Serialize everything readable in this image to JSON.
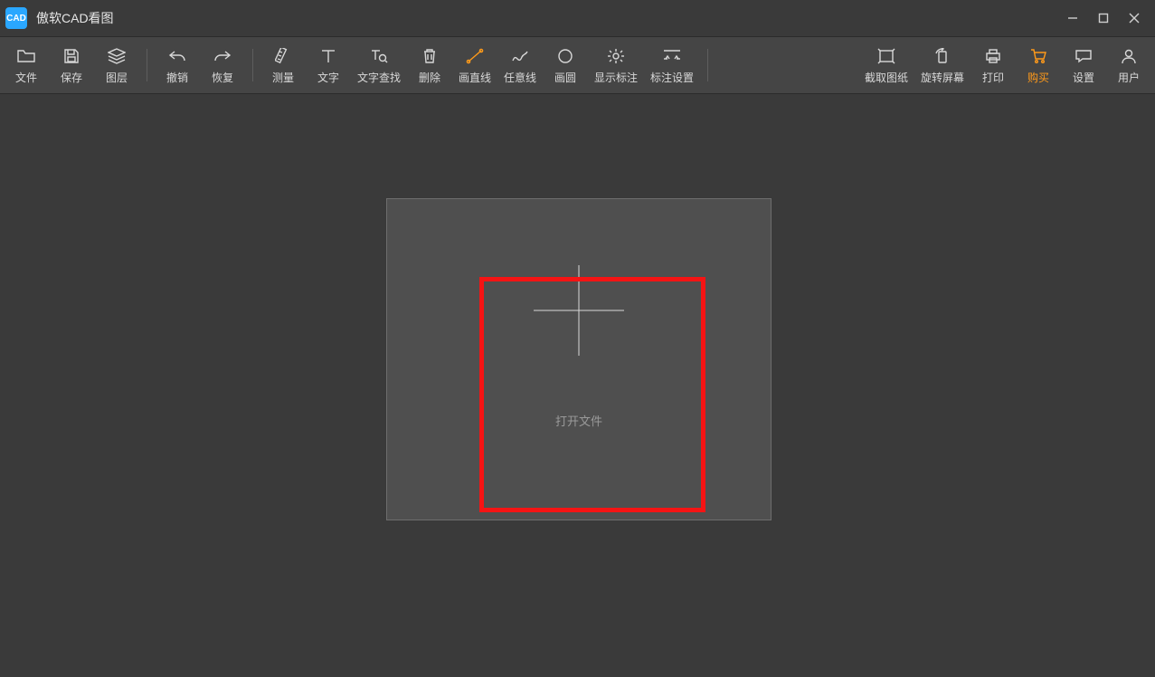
{
  "app": {
    "title": "傲软CAD看图",
    "icon_name": "cad-app-icon",
    "icon_text": "CAD"
  },
  "window_controls": {
    "minimize": "minimize",
    "maximize": "maximize",
    "close": "close"
  },
  "toolbar": {
    "file": {
      "label": "文件",
      "icon": "folder-icon"
    },
    "save": {
      "label": "保存",
      "icon": "save-icon"
    },
    "layers": {
      "label": "图层",
      "icon": "layers-icon"
    },
    "undo": {
      "label": "撤销",
      "icon": "undo-icon"
    },
    "redo": {
      "label": "恢复",
      "icon": "redo-icon"
    },
    "measure": {
      "label": "测量",
      "icon": "ruler-icon"
    },
    "text": {
      "label": "文字",
      "icon": "text-icon"
    },
    "find_text": {
      "label": "文字查找",
      "icon": "find-text-icon"
    },
    "delete": {
      "label": "删除",
      "icon": "trash-icon"
    },
    "line": {
      "label": "画直线",
      "icon": "line-icon"
    },
    "polyline": {
      "label": "任意线",
      "icon": "polyline-icon"
    },
    "circle": {
      "label": "画圆",
      "icon": "circle-icon"
    },
    "show_anno": {
      "label": "显示标注",
      "icon": "show-annotation-icon"
    },
    "anno_set": {
      "label": "标注设置",
      "icon": "annotation-settings-icon"
    },
    "capture": {
      "label": "截取图纸",
      "icon": "capture-icon"
    },
    "rotate": {
      "label": "旋转屏幕",
      "icon": "rotate-screen-icon"
    },
    "print": {
      "label": "打印",
      "icon": "printer-icon"
    },
    "buy": {
      "label": "购买",
      "icon": "cart-icon"
    },
    "settings": {
      "label": "设置",
      "icon": "chat-settings-icon"
    },
    "user": {
      "label": "用户",
      "icon": "user-icon"
    }
  },
  "workspace": {
    "open_file_label": "打开文件"
  },
  "colors": {
    "accent_orange": "#ff9a1a",
    "highlight_red": "#f51414"
  }
}
